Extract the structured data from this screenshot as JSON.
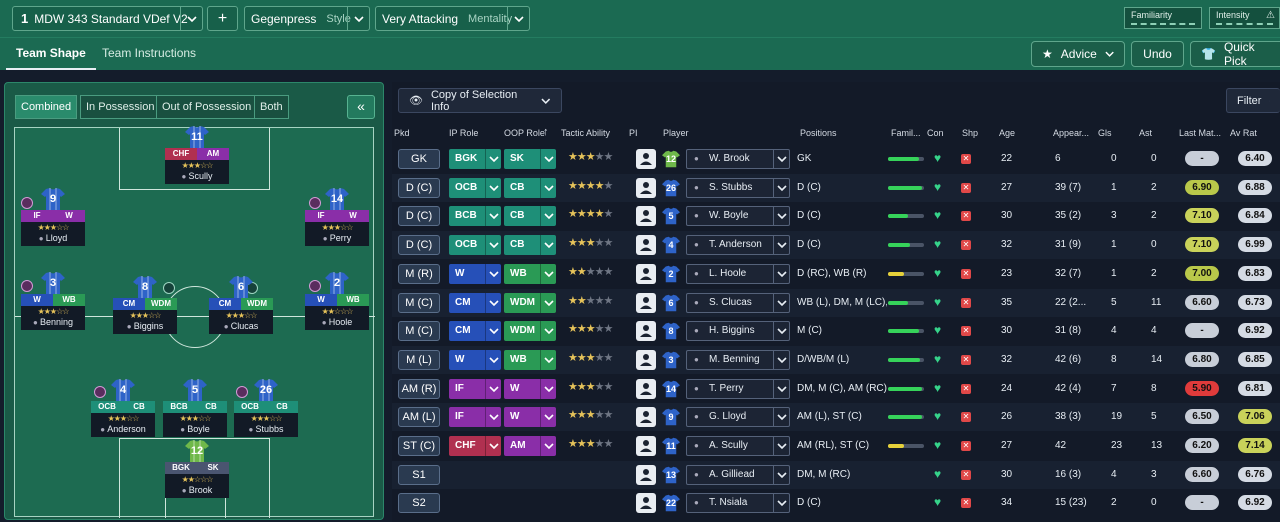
{
  "tactic": {
    "number": "1",
    "name": "MDW 343 Standard VDef V2",
    "style_value": "Gegenpress",
    "style_label": "Style",
    "mentality_value": "Very Attacking",
    "mentality_label": "Mentality"
  },
  "meters": {
    "familiarity": "Familiarity",
    "intensity": "Intensity"
  },
  "tabs": [
    "Team Shape",
    "Team Instructions"
  ],
  "actions": {
    "advice": "Advice",
    "undo": "Undo",
    "quick_pick": "Quick Pick"
  },
  "phase_tabs": [
    "Combined",
    "In Possession",
    "Out of Possession",
    "Both"
  ],
  "collapse": "«",
  "selection_info": "Copy of Selection Info",
  "filter": "Filter",
  "columns": [
    "Pkd",
    "IP Role",
    "OOP Role",
    "Tactic Ability",
    "PI",
    "Player",
    "Positions",
    "Famil...",
    "Con",
    "Shp",
    "Age",
    "Appear...",
    "Gls",
    "Ast",
    "Last Mat...",
    "Av Rat"
  ],
  "colors": {
    "green_role": "#1e8f78",
    "blue_role": "#2650b8",
    "purple_role": "#8a2ea8",
    "red_role": "#b03050",
    "wb_green": "#2a9a55"
  },
  "pitch_players": [
    {
      "num": "11",
      "roles": [
        "CHF",
        "AM"
      ],
      "stars": "★★★☆☆",
      "name": "Scully"
    },
    {
      "num": "9",
      "roles": [
        "IF",
        "W"
      ],
      "stars": "★★★☆☆",
      "name": "Lloyd"
    },
    {
      "num": "14",
      "roles": [
        "IF",
        "W"
      ],
      "stars": "★★★☆☆",
      "name": "Perry"
    },
    {
      "num": "3",
      "roles": [
        "W",
        "WB"
      ],
      "stars": "★★★☆☆",
      "name": "Benning"
    },
    {
      "num": "8",
      "roles": [
        "CM",
        "WDM"
      ],
      "stars": "★★★☆☆",
      "name": "Biggins"
    },
    {
      "num": "6",
      "roles": [
        "CM",
        "WDM"
      ],
      "stars": "★★★☆☆",
      "name": "Clucas"
    },
    {
      "num": "2",
      "roles": [
        "W",
        "WB"
      ],
      "stars": "★★☆☆☆",
      "name": "Hoole"
    },
    {
      "num": "4",
      "roles": [
        "OCB",
        "CB"
      ],
      "stars": "★★★☆☆",
      "name": "Anderson"
    },
    {
      "num": "5",
      "roles": [
        "BCB",
        "CB"
      ],
      "stars": "★★★☆☆",
      "name": "Boyle"
    },
    {
      "num": "26",
      "roles": [
        "OCB",
        "CB"
      ],
      "stars": "★★★☆☆",
      "name": "Stubbs"
    },
    {
      "num": "12",
      "roles": [
        "BGK",
        "SK"
      ],
      "stars": "★★☆☆☆",
      "name": "Brook"
    }
  ],
  "rows": [
    {
      "pkd": "GK",
      "ip": "BGK",
      "oop": "SK",
      "stars": 2.5,
      "kit": "12",
      "player": "W. Brook",
      "positions": "GK",
      "fam": 0.85,
      "age": "22",
      "apps": "6",
      "gls": "0",
      "ast": "0",
      "last": "-",
      "av": "6.40"
    },
    {
      "pkd": "D (C)",
      "ip": "OCB",
      "oop": "CB",
      "stars": 3.5,
      "kit": "26",
      "player": "S. Stubbs",
      "positions": "D (C)",
      "fam": 0.95,
      "age": "27",
      "apps": "39 (7)",
      "gls": "1",
      "ast": "2",
      "last": "6.90",
      "av": "6.88"
    },
    {
      "pkd": "D (C)",
      "ip": "BCB",
      "oop": "CB",
      "stars": 3.5,
      "kit": "5",
      "player": "W. Boyle",
      "positions": "D (C)",
      "fam": 0.55,
      "age": "30",
      "apps": "35 (2)",
      "gls": "3",
      "ast": "2",
      "last": "7.10",
      "av": "6.84"
    },
    {
      "pkd": "D (C)",
      "ip": "OCB",
      "oop": "CB",
      "stars": 3,
      "kit": "4",
      "player": "T. Anderson",
      "positions": "D (C)",
      "fam": 0.6,
      "age": "32",
      "apps": "31 (9)",
      "gls": "1",
      "ast": "0",
      "last": "7.10",
      "av": "6.99"
    },
    {
      "pkd": "M (R)",
      "ip": "W",
      "oop": "WB",
      "stars": 2,
      "kit": "2",
      "player": "L. Hoole",
      "positions": "D (RC), WB (R)",
      "fam": 0.45,
      "age": "23",
      "apps": "32 (7)",
      "gls": "1",
      "ast": "2",
      "last": "7.00",
      "av": "6.83"
    },
    {
      "pkd": "M (C)",
      "ip": "CM",
      "oop": "WDM",
      "stars": 2,
      "kit": "6",
      "player": "S. Clucas",
      "positions": "WB (L), DM, M (LC), A...",
      "fam": 0.55,
      "age": "35",
      "apps": "22 (2...",
      "gls": "5",
      "ast": "11",
      "last": "6.60",
      "av": "6.73"
    },
    {
      "pkd": "M (C)",
      "ip": "CM",
      "oop": "WDM",
      "stars": 2.5,
      "kit": "8",
      "player": "H. Biggins",
      "positions": "M (C)",
      "fam": 0.85,
      "age": "30",
      "apps": "31 (8)",
      "gls": "4",
      "ast": "4",
      "last": "-",
      "av": "6.92"
    },
    {
      "pkd": "M (L)",
      "ip": "W",
      "oop": "WB",
      "stars": 3,
      "kit": "3",
      "player": "M. Benning",
      "positions": "D/WB/M (L)",
      "fam": 0.9,
      "age": "32",
      "apps": "42 (6)",
      "gls": "8",
      "ast": "14",
      "last": "6.80",
      "av": "6.85"
    },
    {
      "pkd": "AM (R)",
      "ip": "IF",
      "oop": "W",
      "stars": 3,
      "kit": "14",
      "player": "T. Perry",
      "positions": "DM, M (C), AM (RC)",
      "fam": 0.95,
      "age": "24",
      "apps": "42 (4)",
      "gls": "7",
      "ast": "8",
      "last": "5.90",
      "av": "6.81"
    },
    {
      "pkd": "AM (L)",
      "ip": "IF",
      "oop": "W",
      "stars": 3,
      "kit": "9",
      "player": "G. Lloyd",
      "positions": "AM (L), ST (C)",
      "fam": 0.95,
      "age": "26",
      "apps": "38 (3)",
      "gls": "19",
      "ast": "5",
      "last": "6.50",
      "av": "7.06"
    },
    {
      "pkd": "ST (C)",
      "ip": "CHF",
      "oop": "AM",
      "stars": 3,
      "kit": "11",
      "player": "A. Scully",
      "positions": "AM (RL), ST (C)",
      "fam": 0.45,
      "age": "27",
      "apps": "42",
      "gls": "23",
      "ast": "13",
      "last": "6.20",
      "av": "7.14"
    },
    {
      "pkd": "S1",
      "ip": "",
      "oop": "",
      "stars": 0,
      "kit": "13",
      "player": "A. Gilliead",
      "positions": "DM, M (RC)",
      "fam": 0,
      "age": "30",
      "apps": "16 (3)",
      "gls": "4",
      "ast": "3",
      "last": "6.60",
      "av": "6.76"
    },
    {
      "pkd": "S2",
      "ip": "",
      "oop": "",
      "stars": 0,
      "kit": "22",
      "player": "T. Nsiala",
      "positions": "D (C)",
      "fam": 0,
      "age": "34",
      "apps": "15 (23)",
      "gls": "2",
      "ast": "0",
      "last": "-",
      "av": "6.92"
    }
  ]
}
